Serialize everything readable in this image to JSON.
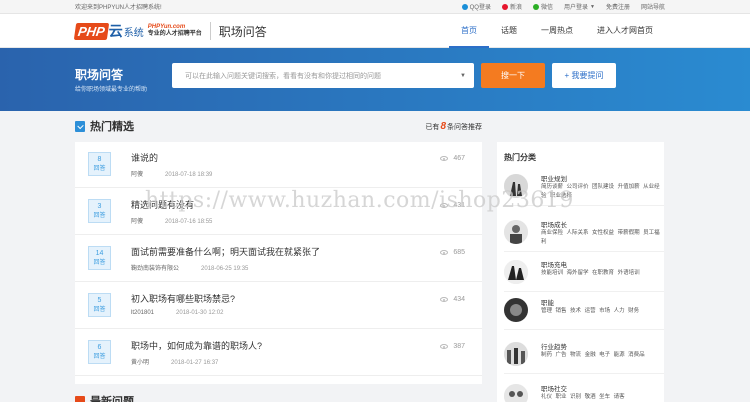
{
  "topbar": {
    "welcome": "欢迎来到PHPYUN人才招聘系统!",
    "links": [
      {
        "label": "QQ登录",
        "icon": "qq-icon",
        "color": "#1a8fd8"
      },
      {
        "label": "新浪",
        "icon": "weibo-icon",
        "color": "#e6162d"
      },
      {
        "label": "微信",
        "icon": "wechat-icon",
        "color": "#2bae25"
      },
      {
        "label": "用户登录",
        "icon": "chevron-down-icon"
      },
      {
        "label": "免费注册"
      },
      {
        "label": "网站导航"
      }
    ]
  },
  "header": {
    "logo_php": "PHP",
    "logo_yun": "云",
    "logo_sys": "系统",
    "logo_url": "PHPYun.com",
    "logo_slogan": "专业的人才招聘平台",
    "section_title": "职场问答",
    "nav": [
      {
        "label": "首页",
        "active": true
      },
      {
        "label": "话题",
        "active": false
      },
      {
        "label": "一周热点",
        "active": false
      },
      {
        "label": "进入人才网首页",
        "active": false
      }
    ]
  },
  "hero": {
    "title": "职场问答",
    "subtitle": "给你职场领域最专业的帮助",
    "search_placeholder": "可以在此输入问题关键词搜索，看看有没有和你提过相同的问题",
    "search_button": "搜一下",
    "ask_button": "+ 我要提问"
  },
  "hot": {
    "title": "热门精选",
    "count_prefix": "已有",
    "count": "8",
    "count_suffix": "条问答推荐",
    "answer_label": "回答",
    "items": [
      {
        "answers": "8",
        "question": "谁说的",
        "author": "阿傻",
        "date": "2018-07-18 18:39",
        "views": "467"
      },
      {
        "answers": "3",
        "question": "精选问题有没有",
        "author": "阿傻",
        "date": "2018-07-16 18:55",
        "views": "431"
      },
      {
        "answers": "14",
        "question": "面试前需要准备什么啊；明天面试我在就紧张了",
        "author": "鞠劲南装饰有限公",
        "date": "2018-06-25 19:35",
        "views": "685"
      },
      {
        "answers": "5",
        "question": "初入职场有哪些职场禁忌?",
        "author": "lt201801",
        "date": "2018-01-30 12:02",
        "views": "434"
      },
      {
        "answers": "6",
        "question": "职场中，如何成为靠谱的职场人?",
        "author": "黄小明",
        "date": "2018-01-27 16:37",
        "views": "387"
      }
    ]
  },
  "sidebar": {
    "title": "热门分类",
    "categories": [
      {
        "name": "职业规划",
        "tags": "简历谈薪 公司评价 团队建设 升值加薪 从业经验 职业选择"
      },
      {
        "name": "职场成长",
        "tags": "商业保险 人际关系 女性权益 带薪假期 员工福利"
      },
      {
        "name": "职场充电",
        "tags": "技能培训 海外留学 在职教育 外语培训"
      },
      {
        "name": "职能",
        "tags": "管理 销售 技术 运营 市场 人力 财务"
      },
      {
        "name": "行业趋势",
        "tags": "制药 广告 物流 金融 电子 能源 消费品"
      },
      {
        "name": "职场社交",
        "tags": "礼仪 职业 识别 敬酒 坐车 请客"
      }
    ]
  },
  "bottom": {
    "title": "最新问题"
  },
  "watermark": "https://www.huzhan.com/ishop23619"
}
